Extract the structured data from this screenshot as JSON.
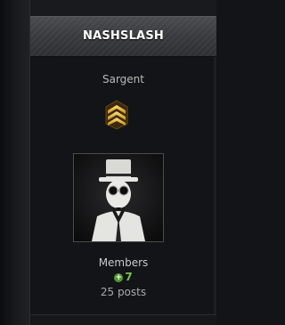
{
  "profile": {
    "username": "NASHSLASH",
    "rank": "Sargent",
    "rank_icon": "sergeant-chevron-icon",
    "group": "Members",
    "reputation": "7",
    "reputation_icon": "plus-circle-icon",
    "posts": "25 posts"
  },
  "colors": {
    "header": "#3a3b3f",
    "background": "#131417",
    "reputation": "#7cc050",
    "rank_badge": "#d9a21b"
  }
}
